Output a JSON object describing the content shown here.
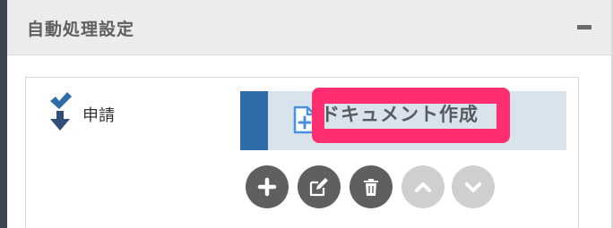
{
  "panel": {
    "title": "自動処理設定",
    "collapse_icon": "minus-icon"
  },
  "trigger": {
    "icon": "arrow-down-check-icon",
    "label": "申請"
  },
  "action": {
    "icon": "document-add-icon",
    "label": "ドキュメント作成",
    "highlight_color": "#ff2f72",
    "stripe_color": "#2f6da8"
  },
  "toolbar": {
    "buttons": [
      {
        "icon": "plus-icon",
        "enabled": true
      },
      {
        "icon": "edit-icon",
        "enabled": true
      },
      {
        "icon": "trash-icon",
        "enabled": true
      },
      {
        "icon": "chevron-up-icon",
        "enabled": false
      },
      {
        "icon": "chevron-down-icon",
        "enabled": false
      }
    ]
  }
}
